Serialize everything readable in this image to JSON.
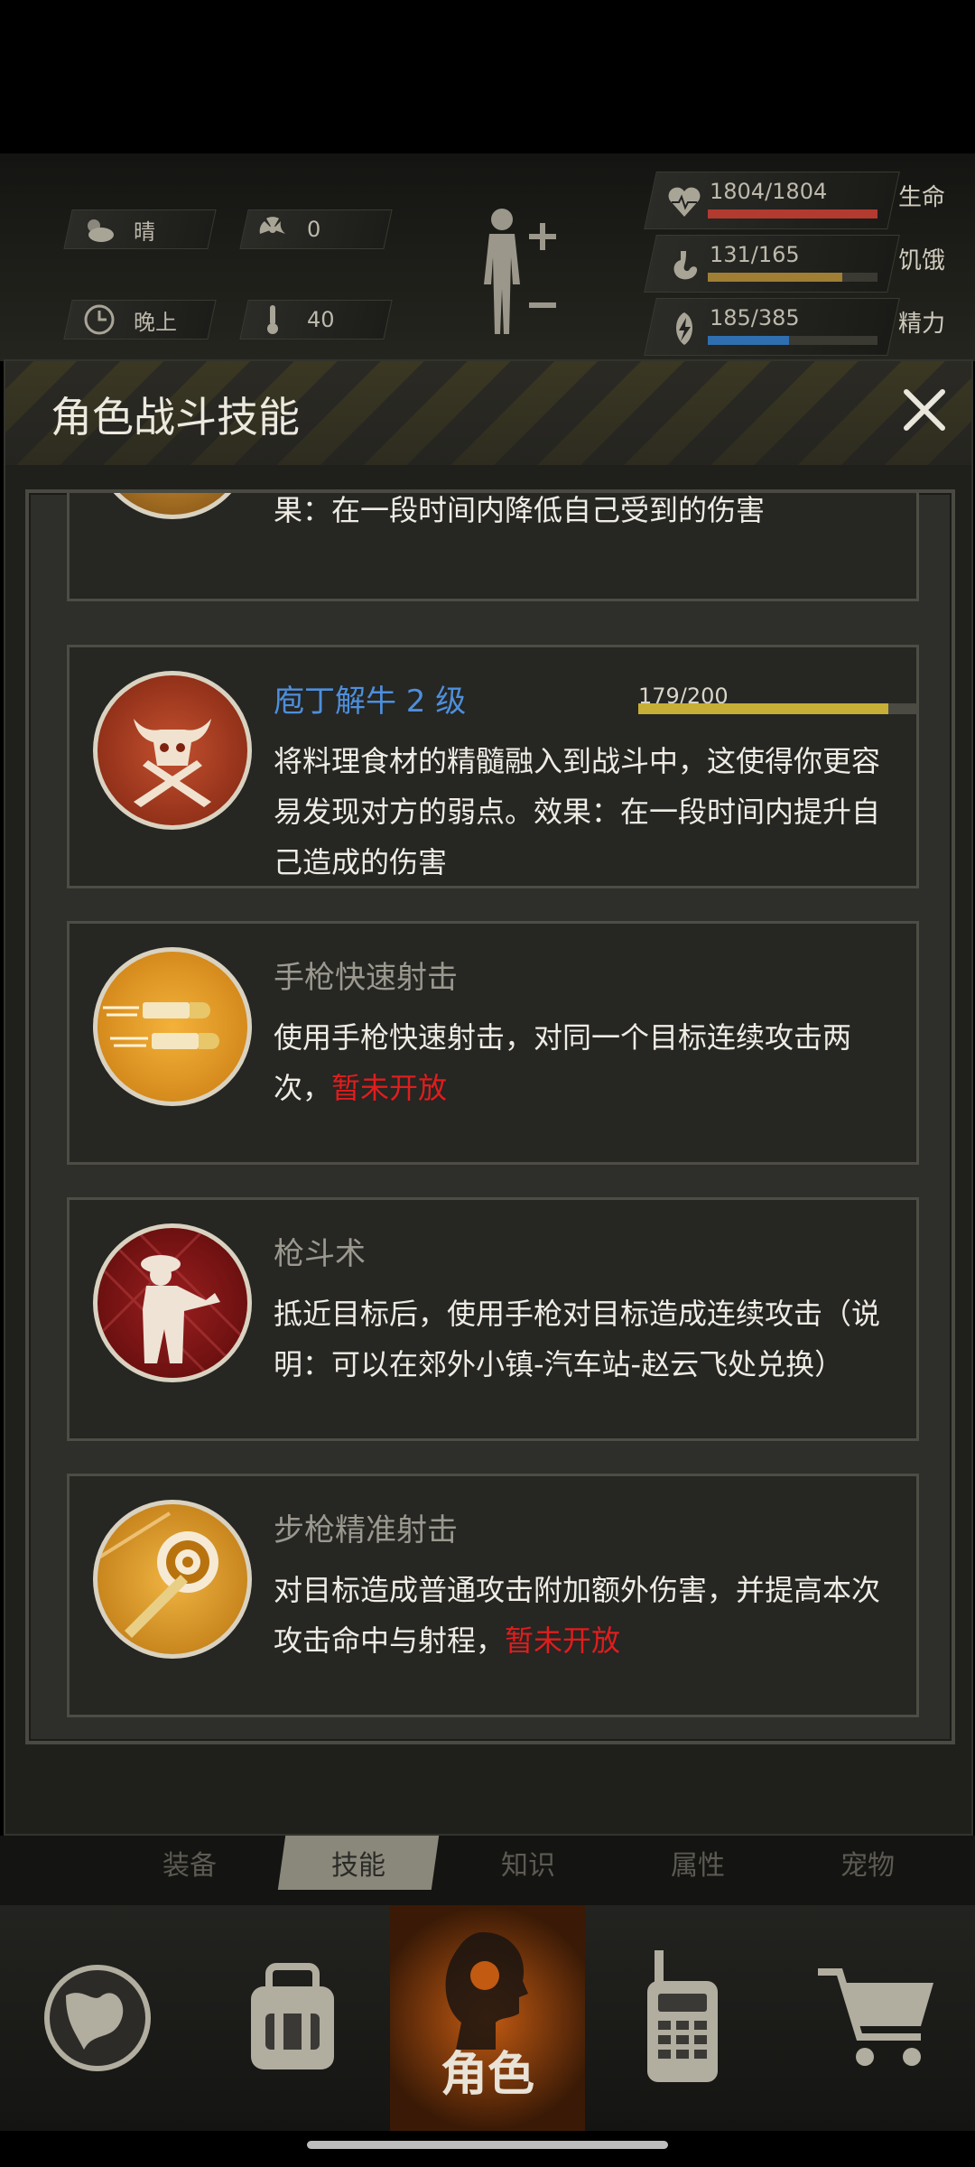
{
  "status": {
    "weather": "晴",
    "radiation": "0",
    "time_of_day": "晚上",
    "temperature": "40",
    "stats": [
      {
        "label": "生命",
        "value": "1804/1804",
        "ratio": 1.0,
        "color": "#b23a2f",
        "icon": "heart-icon"
      },
      {
        "label": "饥饿",
        "value": "131/165",
        "ratio": 0.794,
        "color": "#a07f34",
        "icon": "stomach-icon"
      },
      {
        "label": "精力",
        "value": "185/385",
        "ratio": 0.48,
        "color": "#2f6fb0",
        "icon": "energy-icon"
      }
    ]
  },
  "dialog": {
    "title": "角色战斗技能",
    "skills": [
      {
        "name": "",
        "desc": "果：在一段时间内降低自己受到的伤害",
        "icon": "shield-skill-icon"
      },
      {
        "name": "庖丁解牛 2 级",
        "xp": "179/200",
        "xp_ratio": 0.895,
        "desc": "将料理食材的精髓融入到战斗中，这使得你更容易发现对方的弱点。效果：在一段时间内提升自己造成的伤害",
        "icon": "bull-skull-knives-icon"
      },
      {
        "name": "手枪快速射击",
        "desc": "使用手枪快速射击，对同一个目标连续攻击两次，",
        "locked": "暂未开放",
        "icon": "bullets-icon"
      },
      {
        "name": "枪斗术",
        "desc": "抵近目标后，使用手枪对目标造成连续攻击（说明：可以在郊外小镇-汽车站-赵云飞处兑换）",
        "icon": "gunman-icon"
      },
      {
        "name": "步枪精准射击",
        "desc": "对目标造成普通攻击附加额外伤害，并提高本次攻击命中与射程，",
        "locked": "暂未开放",
        "icon": "target-bullet-icon"
      }
    ]
  },
  "tabs": [
    "装备",
    "技能",
    "知识",
    "属性",
    "宠物"
  ],
  "active_tab": "技能",
  "nav": {
    "active_label": "角色",
    "items": [
      "globe-icon",
      "backpack-icon",
      "character-icon",
      "walkie-talkie-icon",
      "cart-icon"
    ]
  }
}
